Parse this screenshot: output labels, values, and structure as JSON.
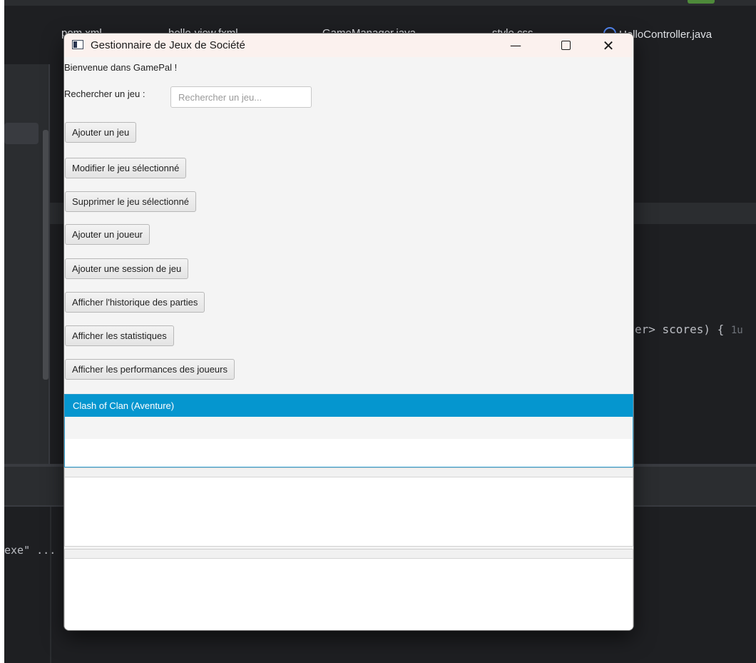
{
  "ide": {
    "tabs": [
      "pom.xml",
      "hello-view.fxml",
      "GameManager.java",
      "style.css",
      "HelloController.java"
    ],
    "code_fragment": "er> scores) {",
    "code_hint": "1u",
    "console_fragment": "exe\" ..."
  },
  "window": {
    "title": "Gestionnaire de Jeux de Société",
    "minimize": "—",
    "close": "✕"
  },
  "main": {
    "welcome": "Bienvenue dans GamePal !",
    "search_label": "Rechercher un jeu :",
    "search_placeholder": "Rechercher un jeu...",
    "search_value": "",
    "buttons": {
      "add_game": "Ajouter un jeu",
      "edit_game": "Modifier le jeu sélectionné",
      "delete_game": "Supprimer le jeu sélectionné",
      "add_player": "Ajouter un joueur",
      "add_session": "Ajouter une session de jeu",
      "show_history": "Afficher l'historique des parties",
      "show_stats": "Afficher les statistiques",
      "show_performance": "Afficher les performances des joueurs"
    },
    "game_list": [
      "Clash of Clan (Aventure)"
    ]
  },
  "colors": {
    "accent": "#0596cf",
    "ide_background": "#1e1f22",
    "titlebar": "#fbf1ee"
  }
}
